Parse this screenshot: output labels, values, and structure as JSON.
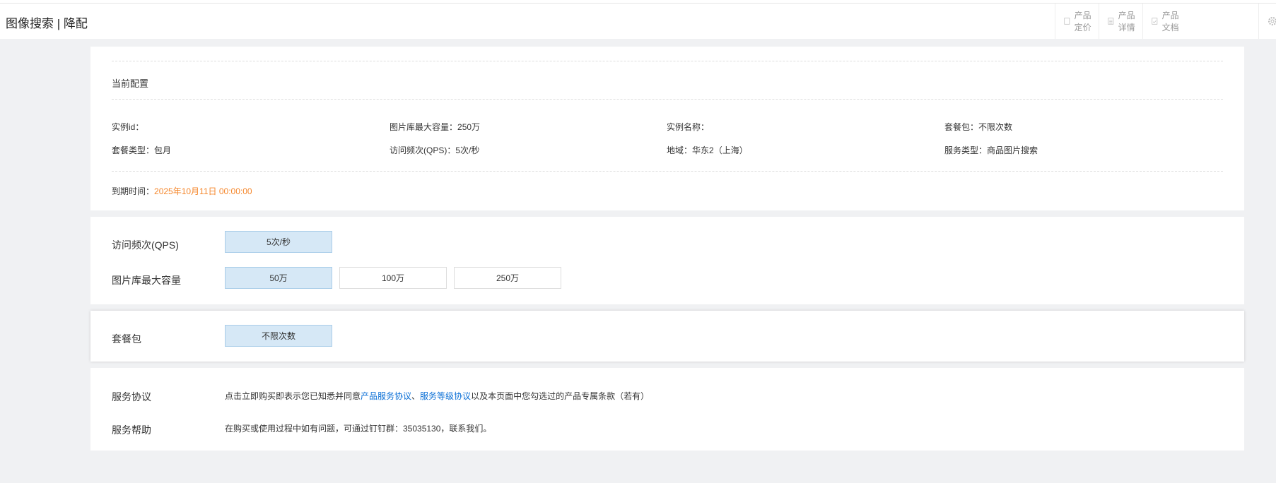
{
  "header": {
    "title": "图像搜索 | 降配",
    "buttons": [
      "产品定价",
      "产品详情",
      "产品文档"
    ]
  },
  "current_config": {
    "heading": "当前配置",
    "fields": [
      {
        "label": "实例id：",
        "value": ""
      },
      {
        "label": "图片库最大容量：",
        "value": "250万"
      },
      {
        "label": "实例名称：",
        "value": ""
      },
      {
        "label": "套餐包：",
        "value": "不限次数"
      },
      {
        "label": "套餐类型：",
        "value": "包月"
      },
      {
        "label": "访问频次(QPS)：",
        "value": "5次/秒"
      },
      {
        "label": "地域：",
        "value": "华东2（上海）"
      },
      {
        "label": "服务类型：",
        "value": "商品图片搜索"
      }
    ],
    "expiry_label": "到期时间：",
    "expiry_value": "2025年10月11日 00:00:00"
  },
  "qps": {
    "label": "访问频次(QPS)",
    "options": [
      "5次/秒"
    ],
    "selected": 0
  },
  "capacity": {
    "label": "图片库最大容量",
    "options": [
      "50万",
      "100万",
      "250万"
    ],
    "selected": 0
  },
  "package": {
    "label": "套餐包",
    "options": [
      "不限次数"
    ],
    "selected": 0
  },
  "agreement": {
    "label": "服务协议",
    "text1": "点击立即购买即表示您已知悉并同意",
    "link1": "产品服务协议",
    "sep": "、",
    "link2": "服务等级协议",
    "text2": "以及本页面中您勾选过的产品专属条款（若有）"
  },
  "help": {
    "label": "服务帮助",
    "text": "在购买或使用过程中如有问题，可通过钉钉群：35035130，联系我们。"
  },
  "colors": {
    "accent": "#f5862a",
    "link": "#0a6fd6",
    "selected_bg": "#d6e8f6"
  }
}
